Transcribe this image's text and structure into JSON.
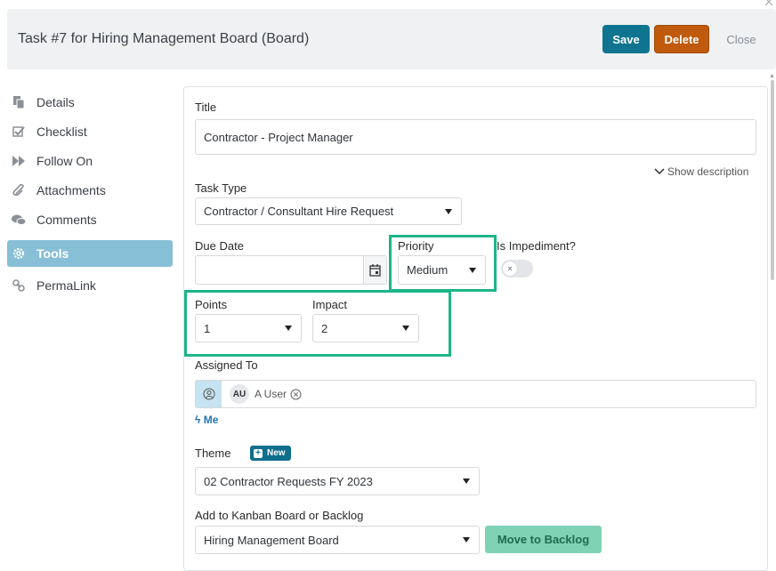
{
  "header": {
    "title": "Task #7 for Hiring Management Board (Board)",
    "save_label": "Save",
    "delete_label": "Delete",
    "close_label": "Close"
  },
  "sidebar": {
    "items": [
      {
        "label": "Details",
        "icon": "copy-icon"
      },
      {
        "label": "Checklist",
        "icon": "checkbox-icon"
      },
      {
        "label": "Follow On",
        "icon": "fast-forward-icon"
      },
      {
        "label": "Attachments",
        "icon": "paperclip-icon"
      },
      {
        "label": "Comments",
        "icon": "comments-icon"
      },
      {
        "label": "Tools",
        "icon": "gear-icon",
        "active": true
      },
      {
        "label": "PermaLink",
        "icon": "link-icon"
      }
    ]
  },
  "form": {
    "title_label": "Title",
    "title_value": "Contractor - Project Manager",
    "show_description": "Show description",
    "task_type_label": "Task Type",
    "task_type_value": "Contractor / Consultant Hire Request",
    "due_date_label": "Due Date",
    "due_date_value": "",
    "priority_label": "Priority",
    "priority_value": "Medium",
    "impediment_label": "Is Impediment?",
    "impediment_value": false,
    "points_label": "Points",
    "points_value": "1",
    "impact_label": "Impact",
    "impact_value": "2",
    "assigned_label": "Assigned To",
    "assignee_initials": "AU",
    "assignee_name": "A User",
    "me_link": "Me",
    "theme_label": "Theme",
    "theme_badge": "New",
    "theme_value": "02 Contractor Requests FY 2023",
    "board_label": "Add to Kanban Board or Backlog",
    "board_value": "Hiring Management Board",
    "move_backlog": "Move to Backlog"
  },
  "colors": {
    "save": "#0e7490",
    "delete": "#c05a0c",
    "active_nav": "#87bfd6",
    "highlight": "#1db58a",
    "backlog_button": "#7fd3b4"
  }
}
